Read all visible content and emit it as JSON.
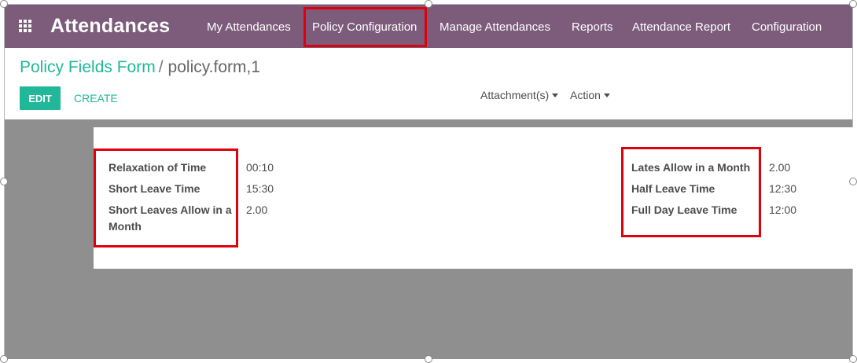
{
  "app": {
    "title": "Attendances"
  },
  "nav": {
    "items": [
      {
        "label": "My Attendances"
      },
      {
        "label": "Policy Configuration"
      },
      {
        "label": "Manage Attendances"
      },
      {
        "label": "Reports"
      },
      {
        "label": "Attendance Report"
      },
      {
        "label": "Configuration"
      }
    ]
  },
  "breadcrumb": {
    "parent": "Policy Fields Form",
    "separator": "/",
    "current": "policy.form,1"
  },
  "buttons": {
    "edit": "EDIT",
    "create": "CREATE"
  },
  "sidebar": {
    "attachments": "Attachment(s)",
    "action": "Action"
  },
  "form": {
    "left_fields": [
      {
        "label": "Relaxation of Time",
        "value": "00:10"
      },
      {
        "label": "Short Leave Time",
        "value": "15:30"
      },
      {
        "label": "Short Leaves Allow in a Month",
        "value": "2.00"
      }
    ],
    "right_fields": [
      {
        "label": "Lates Allow in a Month",
        "value": "2.00"
      },
      {
        "label": "Half Leave Time",
        "value": "12:30"
      },
      {
        "label": "Full Day Leave Time",
        "value": "12:00"
      }
    ]
  },
  "highlight_color": "#e0000b",
  "accent_color": "#21b799",
  "navbar_color": "#7c5b7b"
}
